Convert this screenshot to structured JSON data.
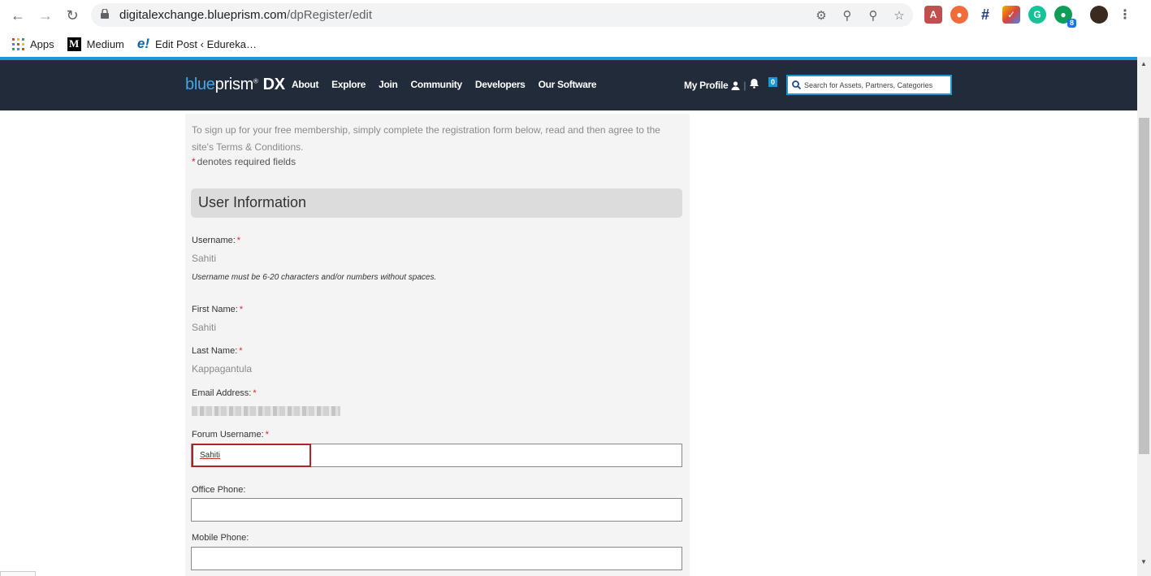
{
  "browser": {
    "url_host": "digitalexchange.blueprism.com",
    "url_path": "/dpRegister/edit",
    "bookmarks": [
      {
        "label": "Apps",
        "icon": "apps-grid-icon"
      },
      {
        "label": "Medium",
        "icon": "medium-logo-icon"
      },
      {
        "label": "Edit Post ‹ Edureka…",
        "icon": "edureka-logo-icon"
      }
    ],
    "extension_badge": "8"
  },
  "site": {
    "logo_blue": "blue",
    "logo_prism": "prism",
    "logo_mark": "®",
    "logo_dx": "DX",
    "nav": [
      "About",
      "Explore",
      "Join",
      "Community",
      "Developers",
      "Our Software"
    ],
    "my_profile": "My Profile",
    "notification_count": "0",
    "search_placeholder": "Search for Assets, Partners, Categories"
  },
  "form": {
    "intro": "To sign up for your free membership, simply complete the registration form below, read and then agree to the site's Terms & Conditions.",
    "required_star": "*",
    "required_note": "denotes required fields",
    "section_title": "User Information",
    "username_label": "Username:",
    "username_value": "Sahiti",
    "username_hint": "Username must be 6-20 characters and/or numbers without spaces.",
    "first_name_label": "First Name:",
    "first_name_value": "Sahiti",
    "last_name_label": "Last Name:",
    "last_name_value": "Kappagantula",
    "email_label": "Email Address:",
    "forum_username_label": "Forum Username:",
    "forum_username_value": "Sahiti",
    "office_phone_label": "Office Phone:",
    "office_phone_value": "",
    "mobile_phone_label": "Mobile Phone:",
    "mobile_phone_value": ""
  },
  "colors": {
    "header_bg": "#222b3a",
    "accent": "#1e96d4",
    "required": "#d9262c",
    "highlight": "#b22327"
  }
}
